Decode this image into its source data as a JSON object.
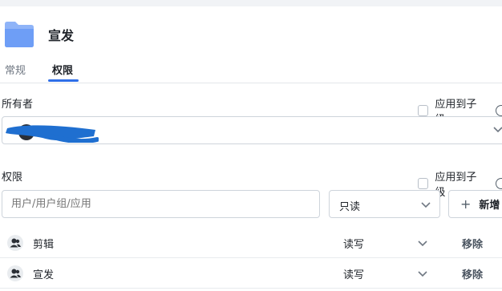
{
  "header": {
    "title": "宣发",
    "folder_icon": "folder-icon",
    "folder_color": "#6e9ef6"
  },
  "tabs": [
    {
      "label": "常规",
      "active": false
    },
    {
      "label": "权限",
      "active": true
    }
  ],
  "owner": {
    "label": "所有者",
    "apply_to_children": {
      "label": "应用到子级",
      "checked": false
    },
    "selected_value_redacted": true
  },
  "permissions": {
    "label": "权限",
    "apply_to_children": {
      "label": "应用到子级",
      "checked": false
    },
    "search": {
      "placeholder": "用户/用户组/应用",
      "value": ""
    },
    "level_select": {
      "value": "只读"
    },
    "add_button": {
      "label": "新增"
    },
    "rows": [
      {
        "name": "剪辑",
        "permission": "读写",
        "remove_label": "移除",
        "icon": "user-group-icon"
      },
      {
        "name": "宣发",
        "permission": "读写",
        "remove_label": "移除",
        "icon": "user-group-icon"
      }
    ]
  },
  "colors": {
    "accent": "#2f6fe8",
    "redaction": "#1f6fd0"
  }
}
